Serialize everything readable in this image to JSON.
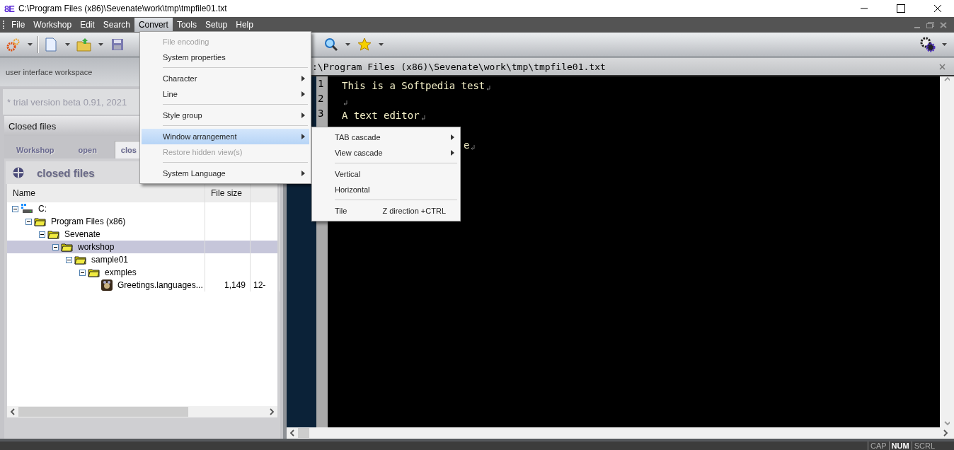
{
  "window": {
    "logo": "8E",
    "title": "C:\\Program Files (x86)\\Sevenate\\work\\tmp\\tmpfile01.txt"
  },
  "menu_bar": [
    {
      "label": "File",
      "selected": false
    },
    {
      "label": "Workshop",
      "selected": false
    },
    {
      "label": "Edit",
      "selected": false
    },
    {
      "label": "Search",
      "selected": false
    },
    {
      "label": "Convert",
      "selected": true
    },
    {
      "label": "Tools",
      "selected": false
    },
    {
      "label": "Setup",
      "selected": false
    },
    {
      "label": "Help",
      "selected": false
    }
  ],
  "convert_menu": [
    {
      "kind": "item",
      "label": "File encoding",
      "disabled": true,
      "submenu": false,
      "selected": false
    },
    {
      "kind": "item",
      "label": "System properties",
      "disabled": false,
      "submenu": false,
      "selected": false
    },
    {
      "kind": "separator"
    },
    {
      "kind": "item",
      "label": "Character",
      "disabled": false,
      "submenu": true,
      "selected": false
    },
    {
      "kind": "item",
      "label": "Line",
      "disabled": false,
      "submenu": true,
      "selected": false
    },
    {
      "kind": "separator"
    },
    {
      "kind": "item",
      "label": "Style group",
      "disabled": false,
      "submenu": true,
      "selected": false
    },
    {
      "kind": "separator"
    },
    {
      "kind": "item",
      "label": "Window arrangement",
      "disabled": false,
      "submenu": true,
      "selected": true
    },
    {
      "kind": "item",
      "label": "Restore hidden view(s)",
      "disabled": true,
      "submenu": false,
      "selected": false
    },
    {
      "kind": "separator"
    },
    {
      "kind": "item",
      "label": "System Language",
      "disabled": false,
      "submenu": true,
      "selected": false
    }
  ],
  "arrangement_submenu": [
    {
      "kind": "item",
      "label": "TAB cascade",
      "submenu": true
    },
    {
      "kind": "item",
      "label": "View cascade",
      "submenu": true
    },
    {
      "kind": "separator"
    },
    {
      "kind": "item",
      "label": "Vertical",
      "submenu": false
    },
    {
      "kind": "item",
      "label": "Horizontal",
      "submenu": false
    },
    {
      "kind": "separator"
    },
    {
      "kind": "item",
      "label": "Tile",
      "submenu": false,
      "shortcut": "Z direction +CTRL"
    }
  ],
  "left_panel": {
    "workspace_label": "user interface workspace",
    "trial_notice": "* trial version beta 0.91, 2021",
    "panel_title": "Closed files",
    "tabs": [
      {
        "label": "Workshop",
        "selected": false
      },
      {
        "label": "open",
        "selected": false
      },
      {
        "label": "clos",
        "selected": true
      }
    ],
    "section_title": "closed files",
    "table": {
      "columns": [
        "Name",
        "File size"
      ],
      "tree": [
        {
          "label": "C:",
          "kind": "drive",
          "selected": false,
          "expanded": true,
          "children": [
            {
              "label": "Program Files (x86)",
              "kind": "folder",
              "selected": false,
              "expanded": true,
              "children": [
                {
                  "label": "Sevenate",
                  "kind": "folder",
                  "selected": false,
                  "expanded": true,
                  "children": [
                    {
                      "label": "workshop",
                      "kind": "folder",
                      "selected": true,
                      "expanded": true,
                      "children": [
                        {
                          "label": "sample01",
                          "kind": "folder",
                          "selected": false,
                          "expanded": true,
                          "children": [
                            {
                              "label": "exmples",
                              "kind": "folder",
                              "selected": false,
                              "expanded": true,
                              "children": [
                                {
                                  "label": "Greetings.languages...",
                                  "kind": "file",
                                  "selected": false,
                                  "size": "1,149",
                                  "column_3": "12-"
                                }
                              ]
                            }
                          ]
                        }
                      ]
                    }
                  ]
                }
              ]
            }
          ]
        }
      ]
    }
  },
  "editor": {
    "path": ":\\Program Files (x86)\\Sevenate\\work\\tmp\\tmpfile01.txt",
    "lines": [
      {
        "number": "1",
        "text": "This is a Softpedia test"
      },
      {
        "number": "2"
      },
      {
        "number": "3",
        "text": "A text editor"
      }
    ],
    "line_5_fragment": "e"
  },
  "status_bar": [
    {
      "label": "CAP",
      "on": false
    },
    {
      "label": "NUM",
      "on": true
    },
    {
      "label": "SCRL",
      "on": false
    }
  ]
}
